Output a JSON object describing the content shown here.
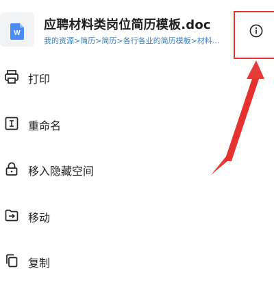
{
  "file": {
    "title": "应聘材料类岗位简历模板.doc",
    "path": "我的资源>简历>简历>各行各业的简历模板>材料…",
    "type_icon": "word-doc-icon",
    "type_letter": "W"
  },
  "info_button": {
    "icon": "info-icon",
    "highlight_color": "#e5322d"
  },
  "menu": [
    {
      "label": "打印",
      "icon": "printer-icon"
    },
    {
      "label": "重命名",
      "icon": "rename-icon"
    },
    {
      "label": "移入隐藏空间",
      "icon": "lock-icon"
    },
    {
      "label": "移动",
      "icon": "move-icon"
    },
    {
      "label": "复制",
      "icon": "copy-icon"
    }
  ],
  "colors": {
    "accent_blue": "#3b82c4",
    "word_icon_blue": "#4a8cf7",
    "annotation_red": "#e5322d"
  }
}
